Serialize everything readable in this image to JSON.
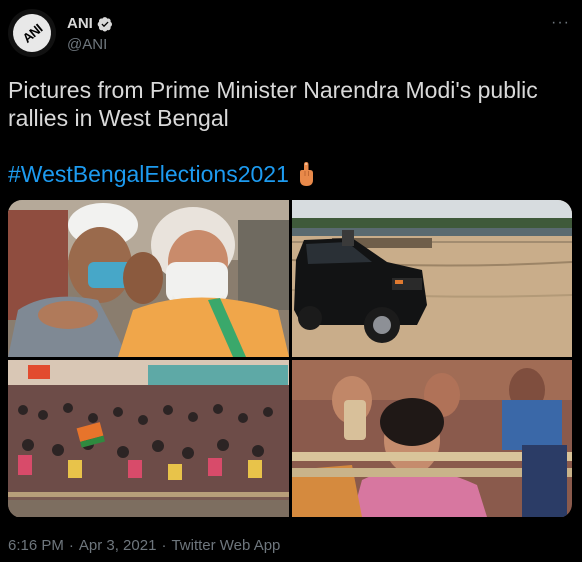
{
  "author": {
    "name": "ANI",
    "handle": "@ANI",
    "avatar_text": "ANI",
    "verified": true
  },
  "more_label": "···",
  "tweet": {
    "text": "Pictures from Prime Minister Narendra Modi's public rallies in West Bengal",
    "hashtag": "#WestBengalElections2021"
  },
  "photos": [
    {
      "name": "photo-modi-embrace"
    },
    {
      "name": "photo-suv-field"
    },
    {
      "name": "photo-rally-crowd"
    },
    {
      "name": "photo-women-crowd"
    }
  ],
  "footer": {
    "time": "6:16 PM",
    "sep1": "·",
    "date": "Apr 3, 2021",
    "sep2": "·",
    "source": "Twitter Web App"
  },
  "colors": {
    "background": "#000000",
    "text": "#d9d9d9",
    "muted": "#6e767d",
    "accent": "#1d9bf0"
  },
  "icons": [
    "verified-badge-icon",
    "more-icon",
    "pointing-finger-icon"
  ]
}
